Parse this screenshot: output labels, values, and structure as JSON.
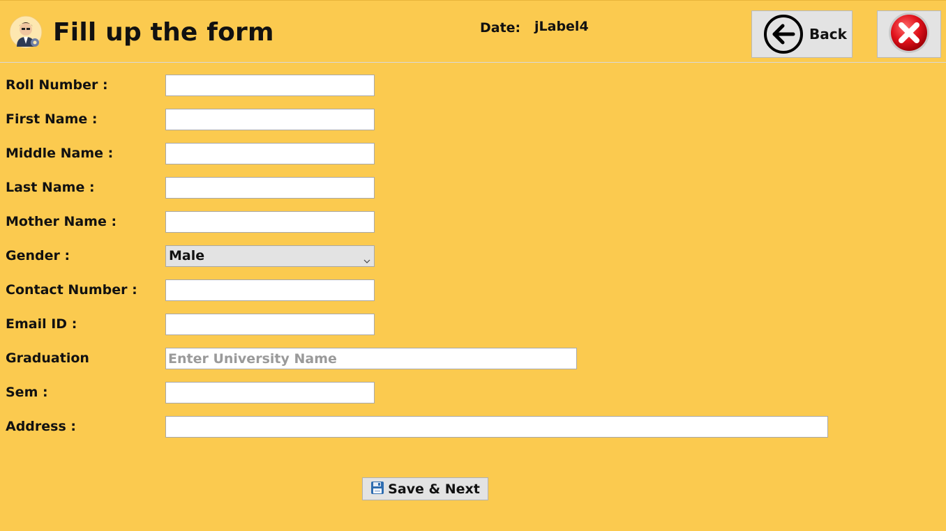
{
  "header": {
    "title": "Fill up the form",
    "date_label": "Date:",
    "date_value": "jLabel4",
    "back_label": "Back",
    "logo_icon": "user-settings-icon",
    "back_icon": "arrow-left-circle-icon",
    "close_icon": "close-circle-icon"
  },
  "form": {
    "roll_number": {
      "label": "Roll Number :",
      "value": ""
    },
    "first_name": {
      "label": "First Name :",
      "value": ""
    },
    "middle_name": {
      "label": "Middle Name :",
      "value": ""
    },
    "last_name": {
      "label": "Last Name :",
      "value": ""
    },
    "mother_name": {
      "label": "Mother Name :",
      "value": ""
    },
    "gender": {
      "label": "Gender :",
      "selected": "Male"
    },
    "contact_number": {
      "label": "Contact Number :",
      "value": ""
    },
    "email_id": {
      "label": "Email ID :",
      "value": ""
    },
    "graduation": {
      "label": "Graduation",
      "value": "",
      "placeholder": "Enter University Name"
    },
    "sem": {
      "label": "Sem :",
      "value": ""
    },
    "address": {
      "label": "Address :",
      "value": ""
    }
  },
  "actions": {
    "save_next_label": "Save & Next",
    "save_icon": "floppy-disk-icon"
  },
  "colors": {
    "background": "#fbca4f",
    "button_bg": "#e3e3e3",
    "close_red": "#e0121b"
  }
}
